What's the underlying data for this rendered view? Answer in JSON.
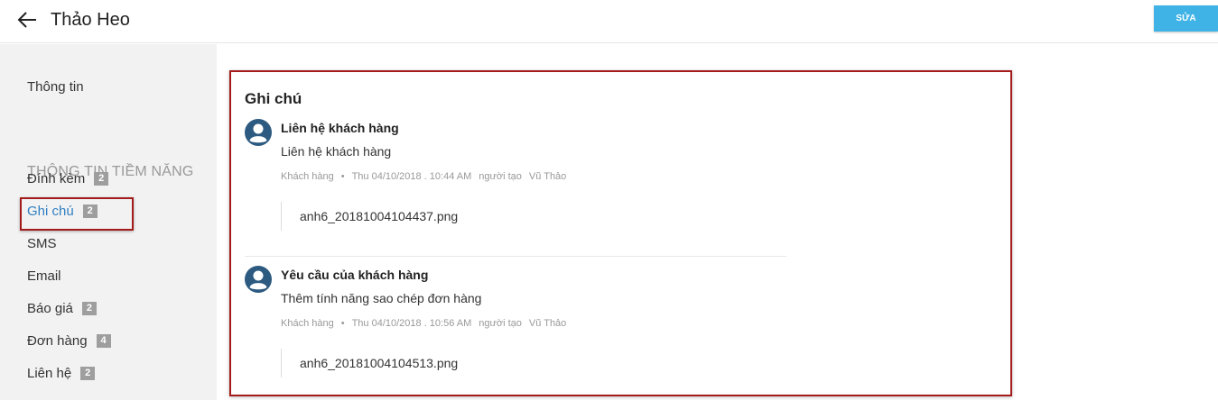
{
  "header": {
    "title": "Thảo Heo",
    "edit_label": "SỬA"
  },
  "sidebar": {
    "info": "Thông tin",
    "group_label": "THÔNG TIN TIỀM NĂNG",
    "items": [
      {
        "label": "Đính kèm",
        "count": "2"
      },
      {
        "label": "Ghi chú",
        "count": "2"
      },
      {
        "label": "SMS"
      },
      {
        "label": "Email"
      },
      {
        "label": "Báo giá",
        "count": "2"
      },
      {
        "label": "Đơn hàng",
        "count": "4"
      },
      {
        "label": "Liên hệ",
        "count": "2"
      }
    ],
    "active_item": "Ghi chú"
  },
  "notes": {
    "title": "Ghi chú",
    "items": [
      {
        "title": "Liên hệ khách hàng",
        "body": "Liên hệ khách hàng",
        "category": "Khách hàng",
        "datetime": "Thu 04/10/2018 . 10:44 AM",
        "creator_label": "người tạo",
        "creator": "Vũ Thảo",
        "attachment": "anh6_20181004104437.png"
      },
      {
        "title": "Yêu cầu của khách hàng",
        "body": "Thêm tính năng sao chép đơn hàng",
        "category": "Khách hàng",
        "datetime": "Thu 04/10/2018 . 10:56 AM",
        "creator_label": "người tạo",
        "creator": "Vũ Thảo",
        "attachment": "anh6_20181004104513.png"
      }
    ]
  },
  "colors": {
    "accent": "#3fb3e6",
    "link": "#2f7fc1",
    "highlight_border": "#a31b1b",
    "avatar": "#2d5a80",
    "badge": "#9e9e9e"
  }
}
